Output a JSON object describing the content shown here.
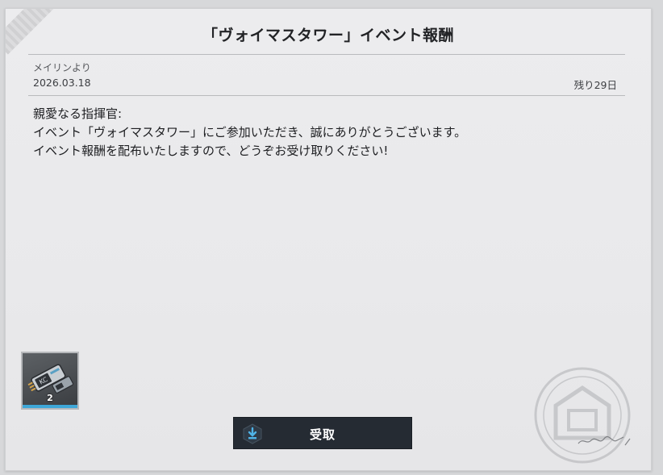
{
  "mail": {
    "title": "「ヴォイマスタワー」イベント報酬",
    "sender": "メイリンより",
    "date": "2026.03.18",
    "remaining": "残り29日",
    "body_lines": [
      "親愛なる指揮官:",
      "イベント「ヴォイマスタワー」にご参加いただき、誠にありがとうございます。",
      "イベント報酬を配布いたしますので、どうぞお受け取りください!"
    ]
  },
  "reward": {
    "icon": "data-chip-icon",
    "count": "2"
  },
  "claim": {
    "label": "受取",
    "icon": "download-icon"
  },
  "colors": {
    "panel_bg": "#ebebed",
    "button_bg": "#252b33",
    "accent_blue": "#3ea7d8"
  }
}
